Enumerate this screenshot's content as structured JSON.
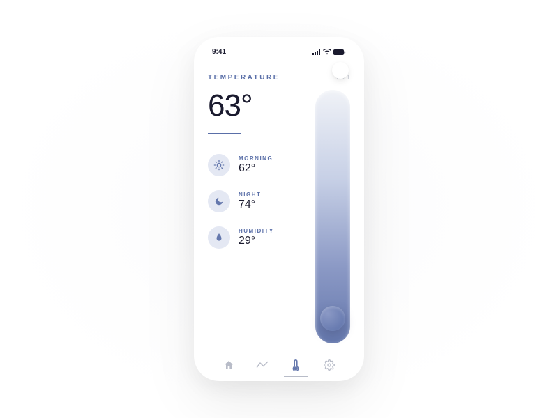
{
  "statusbar": {
    "time": "9:41"
  },
  "header": {
    "title": "TEMPERATURE",
    "date": "5/21"
  },
  "main": {
    "current_temp": "63°"
  },
  "metrics": [
    {
      "label": "MORNING",
      "value": "62°"
    },
    {
      "label": "NIGHT",
      "value": "74°"
    },
    {
      "label": "HUMIDITY",
      "value": "29°"
    }
  ],
  "slider": {
    "position_pct": 14
  },
  "tabs": {
    "active_index": 2,
    "items": [
      "home",
      "analytics",
      "thermostat",
      "settings"
    ]
  },
  "colors": {
    "accent": "#5a6fa8",
    "text": "#1a1a2e",
    "muted": "#c8cbd4",
    "icon_bg": "#e4e8f3"
  }
}
